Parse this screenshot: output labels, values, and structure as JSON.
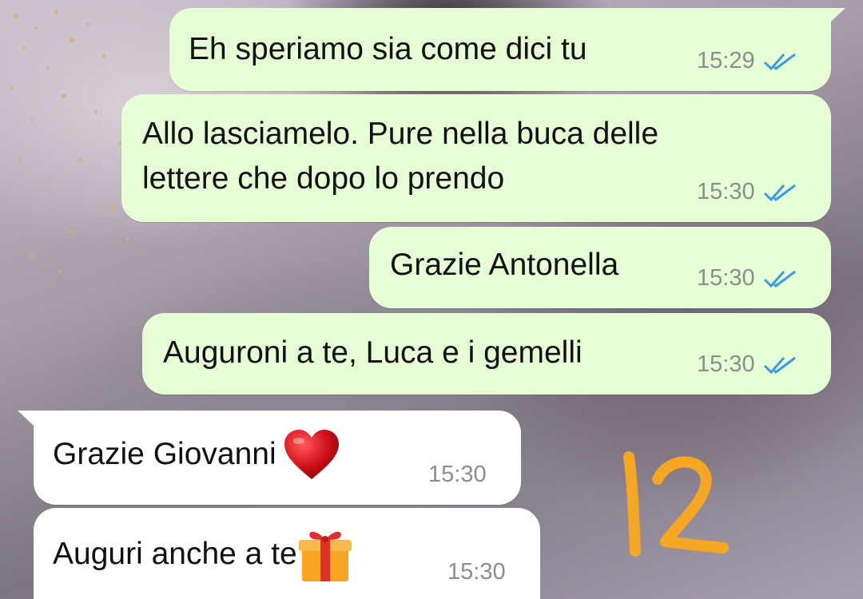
{
  "messages": [
    {
      "text": "Eh speriamo sia come dici tu",
      "time": "15:29",
      "direction": "outgoing",
      "status": "read"
    },
    {
      "line1": "Allo lasciamelo. Pure nella buca delle",
      "line2": "lettere che dopo lo prendo",
      "time": "15:30",
      "direction": "outgoing",
      "status": "read"
    },
    {
      "text": "Grazie Antonella",
      "time": "15:30",
      "direction": "outgoing",
      "status": "read"
    },
    {
      "text": "Auguroni a te, Luca e i gemelli",
      "time": "15:30",
      "direction": "outgoing",
      "status": "read"
    },
    {
      "text": "Grazie Giovanni",
      "emoji": "heart-icon",
      "time": "15:30",
      "direction": "incoming"
    },
    {
      "text": "Auguri anche a te",
      "emoji": "gift-icon",
      "time": "15:30",
      "direction": "incoming"
    }
  ],
  "overlay": {
    "label": "12",
    "color": "#f5a623"
  },
  "colors": {
    "outgoing_bubble": "#e7fdd5",
    "incoming_bubble": "#ffffff",
    "read_ticks": "#3b9ce0",
    "timestamp": "#8a8f8a"
  }
}
